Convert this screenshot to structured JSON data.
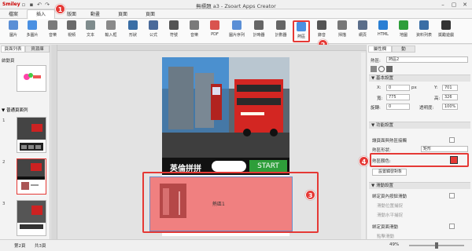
{
  "titlebar": {
    "logo": "Smiley",
    "title": "無標題 a3 - Zsoart Apps Creator"
  },
  "menus": [
    "檔案",
    "插入",
    "版面",
    "動畫",
    "頁面",
    "頁面"
  ],
  "toolbar": [
    "圖片",
    "多圖片",
    "音樂",
    "視頻",
    "文本",
    "輸入框",
    "形狀",
    "公式",
    "符號",
    "音樂",
    "PDF",
    "圖片序列",
    "計時器",
    "計數器",
    "熱區",
    "錄音",
    "掃描",
    "網頁",
    "HTML",
    "地圖",
    "資料列表",
    "獎勵遊戲"
  ],
  "left_panel": {
    "tabs": [
      "頁面列表",
      "資源庫"
    ],
    "section_intro": "啟動頁",
    "section_main": "▼ 普通頁面列",
    "page_numbers": [
      "1",
      "2",
      "3"
    ],
    "thumb_labels": [
      "英倫拼拼",
      "START"
    ]
  },
  "canvas": {
    "game_title": "英倫拼拼",
    "start_label": "START",
    "hotzone_label": "熱區1"
  },
  "right_panel": {
    "tabs": [
      "屬性欄",
      "動"
    ],
    "name_label": "熱區:",
    "name_value": "熱區2",
    "basic_group": "▼ 基本設置",
    "x_label": "X:",
    "x_value": "0",
    "y_label": "Y:",
    "y_value": "701",
    "px": "px",
    "w_label": "寬:",
    "w_value": "775",
    "h_label": "高:",
    "h_value": "326",
    "rot_label": "旋轉:",
    "rot_value": "0",
    "opacity_label": "透明度:",
    "opacity_value": "100%",
    "func_group": "▼ 功能設置",
    "auto_label": "讓頁面與熱區接觸",
    "shape_label": "熱區形狀:",
    "shape_value": "矩形",
    "color_label": "熱區顏色:",
    "trigger_btn": "設置觸發對象",
    "scroll_group": "▼ 滑動設置",
    "s1": "綁定頁內按鈕滑動",
    "s2": "滑動位置捕捉",
    "s3": "滑動水平捕捉",
    "s4": "綁定頁面滑動",
    "s5": "點擊滑動",
    "s6": "滑動水平位置"
  },
  "status": {
    "page": "第2頁",
    "total": "共3頁",
    "zoom": "49%"
  },
  "steps": [
    "1",
    "2",
    "3",
    "4"
  ],
  "colors": {
    "accent": "#e53935",
    "hotzone": "#f08080",
    "start": "#2e9e3a"
  }
}
